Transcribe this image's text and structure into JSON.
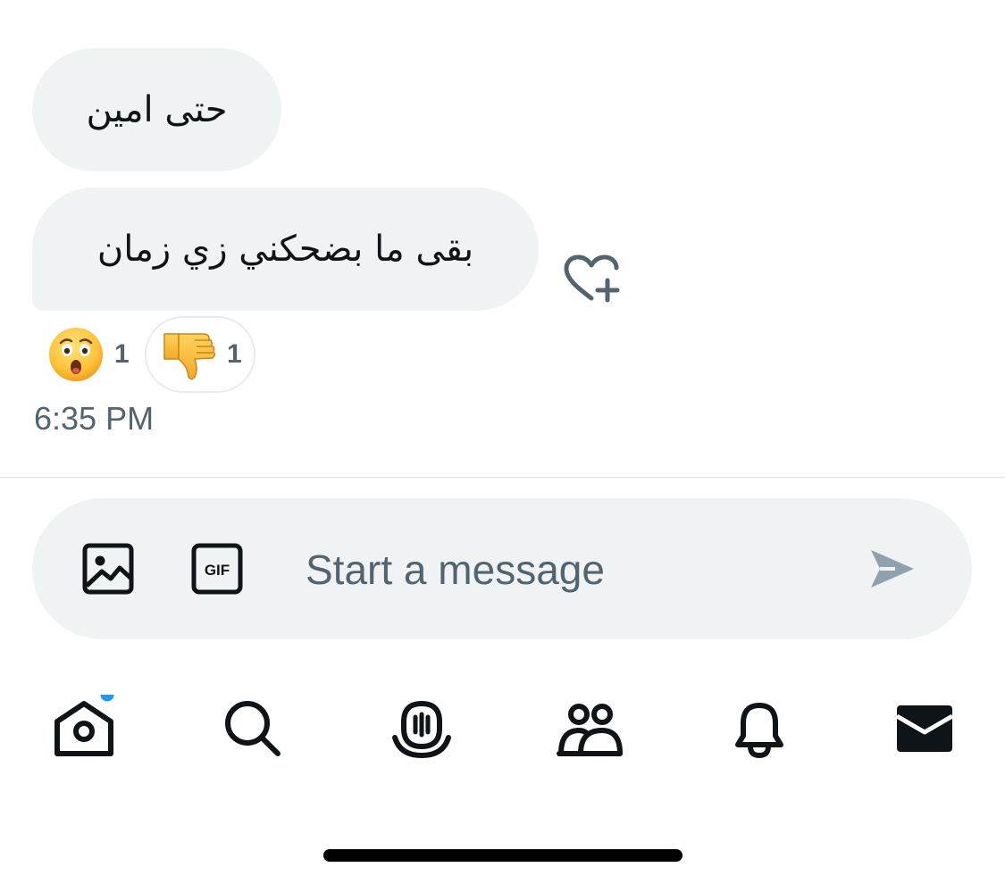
{
  "conversation": {
    "messages": [
      {
        "text": "حتى امين"
      },
      {
        "text": "بقى ما بضحكني زي زمان"
      }
    ],
    "reactions": [
      {
        "emoji": "astonished-face",
        "count": "1"
      },
      {
        "emoji": "thumbs-down",
        "count": "1"
      }
    ],
    "timestamp": "6:35 PM"
  },
  "composer": {
    "placeholder": "Start a message",
    "gif_label": "GIF"
  },
  "nav": {
    "tabs": [
      "home-icon",
      "search-icon",
      "spaces-icon",
      "communities-icon",
      "notifications-icon",
      "messages-icon"
    ],
    "home_badge_color": "#1d9bf0"
  },
  "colors": {
    "bubble": "#eff3f4",
    "secondary_text": "#536471",
    "send_disabled": "#8fa1ae"
  }
}
